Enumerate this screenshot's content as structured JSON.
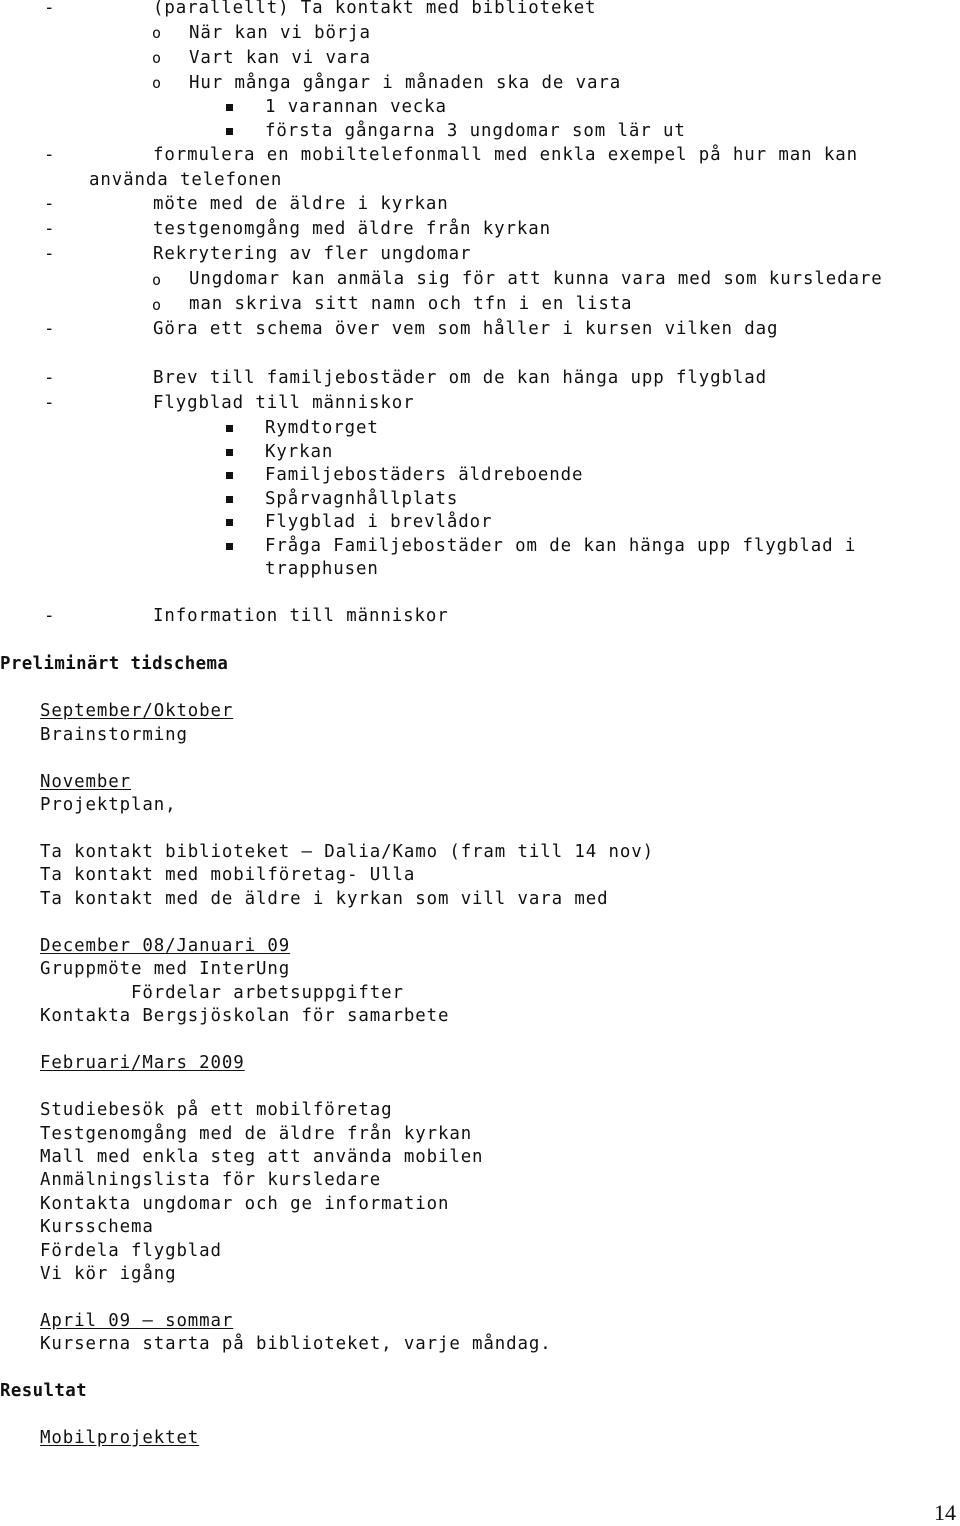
{
  "list": {
    "dash_marker": "-",
    "circle_marker": "o",
    "items": [
      {
        "text": "(parallellt) Ta kontakt med biblioteket"
      },
      {
        "text": "När kan vi börja"
      },
      {
        "text": "Vart kan vi vara"
      },
      {
        "text": "Hur många gångar i månaden ska de vara"
      },
      {
        "text": "1 varannan vecka"
      },
      {
        "text": "första gångarna 3 ungdomar som lär ut"
      },
      {
        "text": "formulera en mobiltelefonmall med enkla exempel på hur man kan"
      },
      {
        "text": "använda telefonen"
      },
      {
        "text": "möte med de äldre i kyrkan"
      },
      {
        "text": "testgenomgång med äldre från kyrkan"
      },
      {
        "text": "Rekrytering av fler ungdomar"
      },
      {
        "text": "Ungdomar kan anmäla sig för att kunna vara med som kursledare"
      },
      {
        "text": "man skriva sitt namn och tfn i en lista"
      },
      {
        "text": "Göra ett schema över vem som håller i kursen vilken dag"
      },
      {
        "text": "Brev till familjebostäder om de kan hänga upp flygblad"
      },
      {
        "text": "Flygblad till människor"
      },
      {
        "text": "Rymdtorget"
      },
      {
        "text": "Kyrkan"
      },
      {
        "text": "Familjebostäders äldreboende"
      },
      {
        "text": "Spårvagnhållplats"
      },
      {
        "text": "Flygblad i brevlådor"
      },
      {
        "text": "Fråga Familjebostäder om de kan hänga upp flygblad i"
      },
      {
        "text": "trapphusen"
      },
      {
        "text": "Information till människor"
      }
    ]
  },
  "schedule": {
    "heading": "Preliminärt tidschema",
    "periods": [
      {
        "title": "September/Oktober",
        "lines": [
          "Brainstorming"
        ]
      },
      {
        "title": "November",
        "lines": [
          "Projektplan,",
          "",
          "Ta kontakt biblioteket – Dalia/Kamo (fram till 14 nov)",
          "Ta kontakt med mobilföretag- Ulla",
          "Ta kontakt med de äldre i kyrkan som vill vara med"
        ]
      },
      {
        "title": "December 08/Januari 09",
        "lines": [
          "Gruppmöte med InterUng",
          "        Fördelar arbetsuppgifter",
          "Kontakta Bergsjöskolan för samarbete"
        ]
      },
      {
        "title": "Februari/Mars 2009",
        "lines": [
          "",
          "Studiebesök på ett mobilföretag",
          "Testgenomgång med de äldre från kyrkan",
          "Mall med enkla steg att använda mobilen",
          "Anmälningslista för kursledare",
          "Kontakta ungdomar och ge information",
          "Kursschema",
          "Fördela flygblad",
          "Vi kör igång"
        ]
      },
      {
        "title": "April 09 – sommar",
        "lines": [
          "Kurserna starta på biblioteket, varje måndag."
        ]
      }
    ]
  },
  "results": {
    "heading": "Resultat",
    "subheading": "Mobilprojektet"
  },
  "page_number": "14"
}
